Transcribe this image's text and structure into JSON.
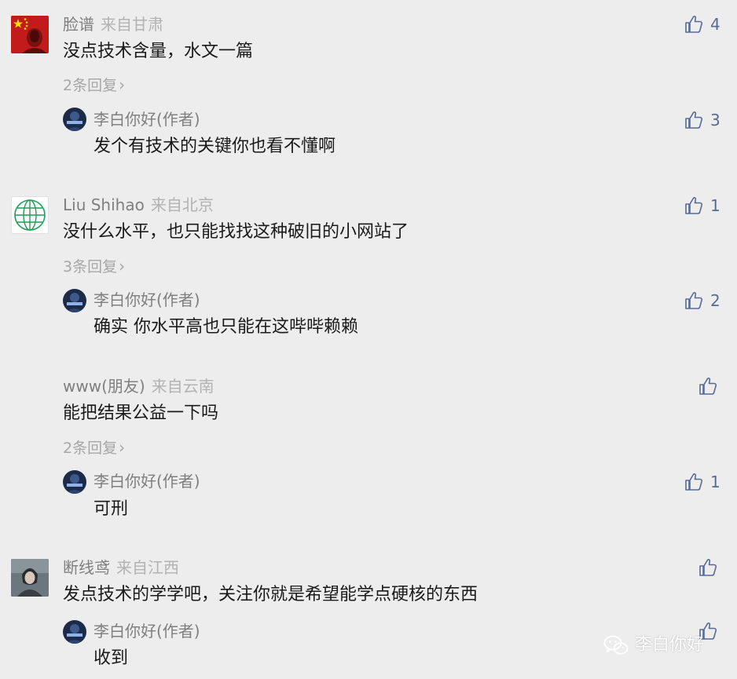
{
  "comments": [
    {
      "author": "脸谱",
      "location": "来自甘肃",
      "text": "没点技术含量，水文一篇",
      "likes": "4",
      "replies_link": "2条回复",
      "reply": {
        "author": "李白你好(作者)",
        "text": "发个有技术的关键你也看不懂啊",
        "likes": "3"
      }
    },
    {
      "author": "Liu Shihao",
      "location": "来自北京",
      "text": "没什么水平，也只能找找这种破旧的小网站了",
      "likes": "1",
      "replies_link": "3条回复",
      "reply": {
        "author": "李白你好(作者)",
        "text": "确实 你水平高也只能在这哔哔赖赖",
        "likes": "2"
      }
    },
    {
      "author": "www(朋友)",
      "location": "来自云南",
      "text": "能把结果公益一下吗",
      "likes": "",
      "replies_link": "2条回复",
      "reply": {
        "author": "李白你好(作者)",
        "text": "可刑",
        "likes": "1"
      }
    },
    {
      "author": "断线鸢",
      "location": "来自江西",
      "text": "发点技术的学学吧，关注你就是希望能学点硬核的东西",
      "likes": "",
      "reply": {
        "author": "李白你好(作者)",
        "text": "收到",
        "likes": ""
      }
    }
  ],
  "watermark": {
    "text": "李白你好"
  },
  "colors": {
    "background": "#ededed",
    "like": "#576b95",
    "meta": "#7f7f7f",
    "location": "#b2b2b2"
  },
  "icons": {
    "like": "thumbs-up-icon",
    "chevron": "chevron-right-icon",
    "watermark": "wechat-icon"
  }
}
